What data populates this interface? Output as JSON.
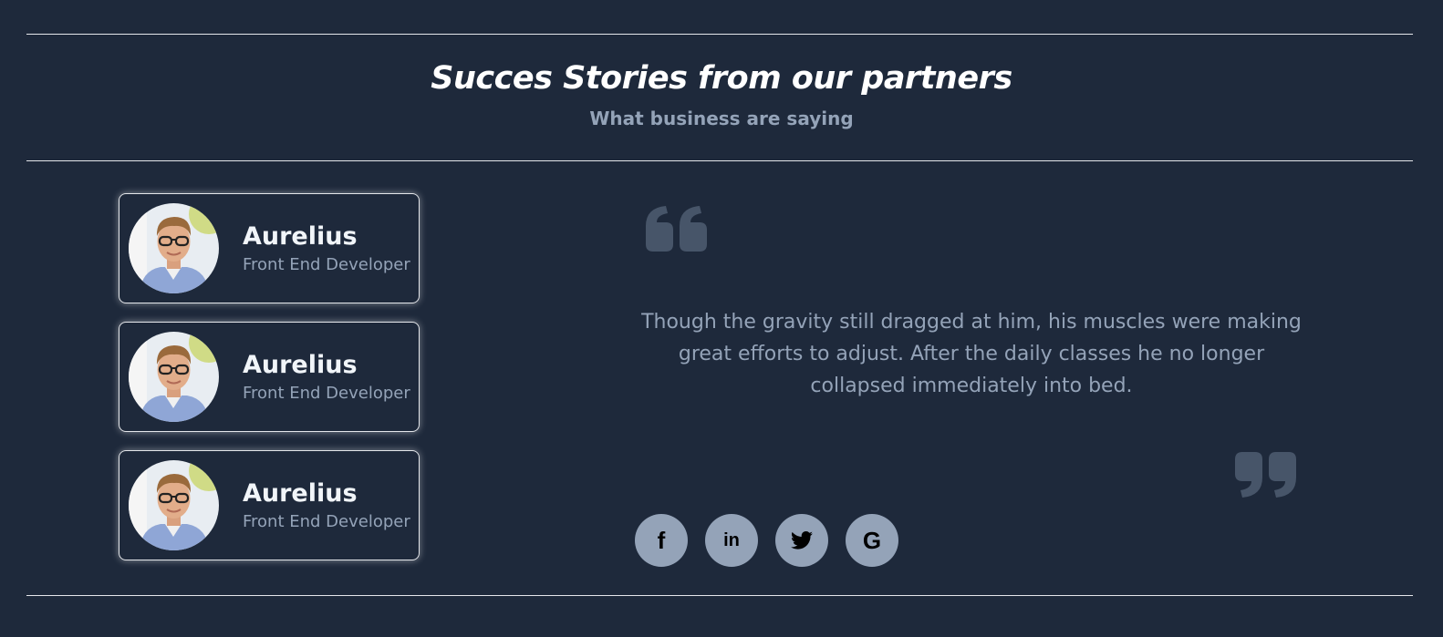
{
  "header": {
    "title": "Succes Stories from our partners",
    "subtitle": "What business are saying"
  },
  "testimonials": [
    {
      "name": "Aurelius",
      "role": "Front End Developer"
    },
    {
      "name": "Aurelius",
      "role": "Front End Developer"
    },
    {
      "name": "Aurelius",
      "role": "Front End Developer"
    }
  ],
  "quote": {
    "text": "Though the gravity still dragged at him, his muscles were making great efforts to adjust. After the daily classes he no longer collapsed immediately into bed."
  },
  "social": [
    {
      "icon": "facebook-icon",
      "glyph": "f"
    },
    {
      "icon": "linkedin-icon",
      "glyph": "in"
    },
    {
      "icon": "twitter-icon",
      "glyph": ""
    },
    {
      "icon": "google-icon",
      "glyph": "G"
    }
  ],
  "colors": {
    "background": "#1e293b",
    "heading": "#ffffff",
    "muted": "#94a3b8",
    "quote_mark": "#475569",
    "social_button": "#94a3b8"
  }
}
